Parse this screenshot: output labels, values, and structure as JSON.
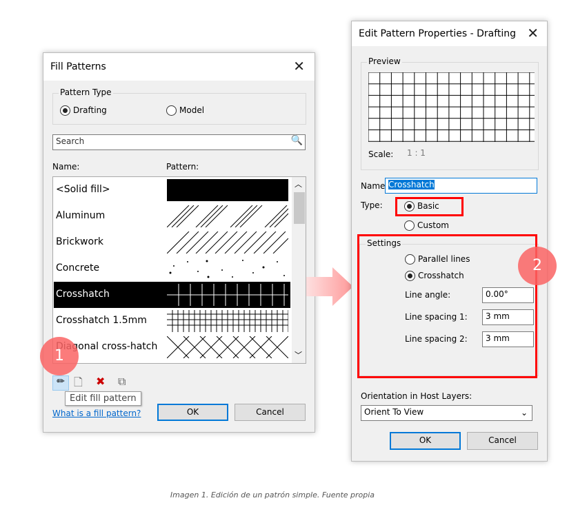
{
  "fill_patterns": {
    "title": "Fill Patterns",
    "pattern_type_label": "Pattern Type",
    "drafting": "Drafting",
    "model": "Model",
    "search_placeholder": "Search",
    "name_header": "Name:",
    "pattern_header": "Pattern:",
    "items": [
      {
        "name": "<Solid fill>"
      },
      {
        "name": "Aluminum"
      },
      {
        "name": "Brickwork"
      },
      {
        "name": "Concrete"
      },
      {
        "name": "Crosshatch"
      },
      {
        "name": "Crosshatch 1.5mm"
      },
      {
        "name": "Diagonal cross-hatch"
      }
    ],
    "selected": "Crosshatch",
    "tooltip": "Edit fill pattern",
    "help_link": "What is a fill pattern?",
    "ok": "OK",
    "cancel": "Cancel"
  },
  "edit_pattern": {
    "title": "Edit Pattern Properties - Drafting",
    "preview_label": "Preview",
    "scale_label": "Scale:",
    "scale_value": "1 : 1",
    "name_label": "Name:",
    "name_value": "Crosshatch",
    "type_label": "Type:",
    "basic": "Basic",
    "custom": "Custom",
    "settings_label": "Settings",
    "parallel": "Parallel lines",
    "crosshatch": "Crosshatch",
    "line_angle_label": "Line angle:",
    "line_angle": "0.00°",
    "spacing1_label": "Line spacing 1:",
    "spacing1": "3 mm",
    "spacing2_label": "Line spacing 2:",
    "spacing2": "3 mm",
    "orientation_label": "Orientation in Host Layers:",
    "orientation_value": "Orient To View",
    "ok": "OK",
    "cancel": "Cancel"
  },
  "badges": {
    "one": "1",
    "two": "2"
  },
  "caption": "Imagen 1. Edición de un patrón simple. Fuente propia",
  "colors": {
    "highlight": "#f00",
    "badge": "#fa6464",
    "accent": "#0078d7"
  }
}
